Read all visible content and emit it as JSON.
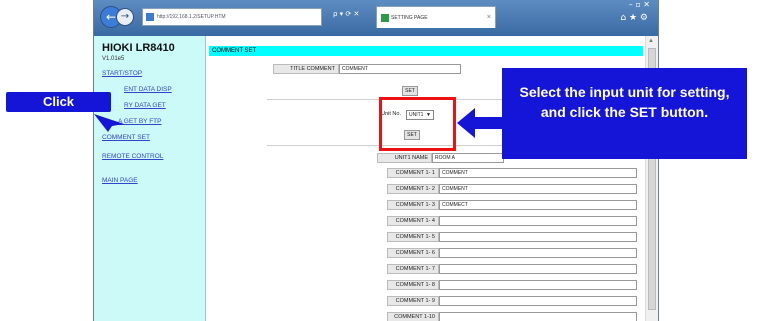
{
  "browser": {
    "address_url": "http://192.168.1.2/SETUP.HTM",
    "address_tools": "ρ ▾ ⟳ ✕",
    "tab_title": "SETTING PAGE",
    "tab_close": "×",
    "window_controls": "–  ▫  ✕",
    "toolbar_icons": "⌂ ★ ⚙"
  },
  "sidebar": {
    "device_name": "HIOKI LR8410",
    "device_version": "V1.01e5",
    "links": [
      {
        "label": "START/STOP"
      },
      {
        "label": "ENT DATA DISP"
      },
      {
        "label": "RY DATA GET"
      },
      {
        "label": "A GET BY FTP"
      },
      {
        "label": "COMMENT SET"
      },
      {
        "label": "REMOTE CONTROL"
      },
      {
        "label": "MAIN PAGE"
      }
    ]
  },
  "main": {
    "section_title": "COMMENT SET",
    "title_comment_label": "TITLE COMMENT",
    "title_comment_value": "COMMENT",
    "set_button": "SET",
    "unit_no_label": "Unit No.",
    "unit_no_value": "UNIT1",
    "unit_name_label": "UNIT1 NAME",
    "unit_name_value": "ROOM A",
    "comments": [
      {
        "label": "COMMENT 1- 1",
        "value": "COMMENT"
      },
      {
        "label": "COMMENT 1- 2",
        "value": "COMMENT"
      },
      {
        "label": "COMMENT 1- 3",
        "value": "COMMECT"
      },
      {
        "label": "COMMENT 1- 4",
        "value": ""
      },
      {
        "label": "COMMENT 1- 5",
        "value": ""
      },
      {
        "label": "COMMENT 1- 6",
        "value": ""
      },
      {
        "label": "COMMENT 1- 7",
        "value": ""
      },
      {
        "label": "COMMENT 1- 8",
        "value": ""
      },
      {
        "label": "COMMENT 1- 9",
        "value": ""
      },
      {
        "label": "COMMENT 1-10",
        "value": ""
      }
    ]
  },
  "annotations": {
    "click_label": "Click",
    "callout_text": "Select the input unit for setting, and click the SET button.",
    "accent_blue": "#1515d8",
    "highlight_red": "#ee1111"
  }
}
